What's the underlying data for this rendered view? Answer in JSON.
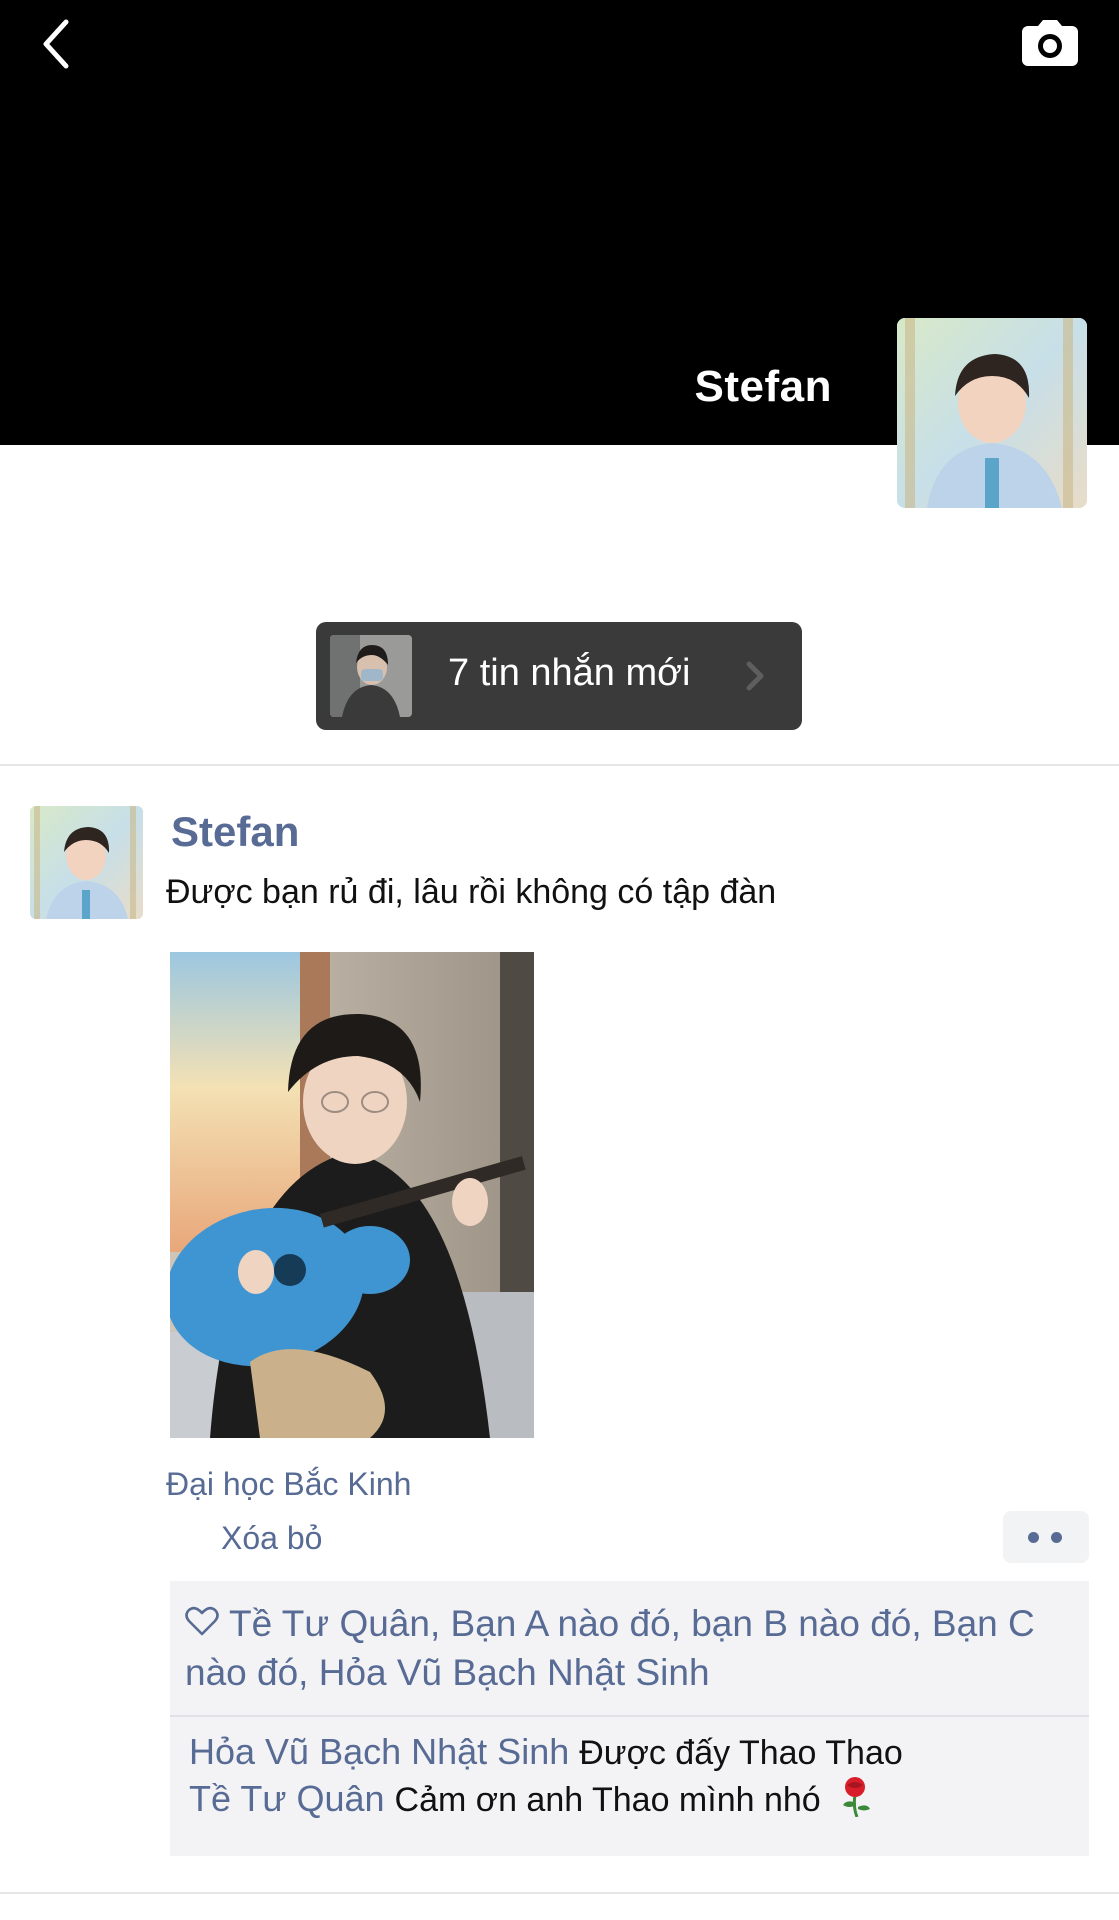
{
  "header": {
    "back_icon": "back-chevron-icon",
    "camera_icon": "camera-icon",
    "profile_name": "Stefan"
  },
  "new_messages": {
    "label": "7 tin nhắn mới",
    "chevron_icon": "chevron-right-icon"
  },
  "post": {
    "author": "Stefan",
    "text": "Được bạn rủ đi, lâu rồi không có tập đàn",
    "location": "Đại học Bắc Kinh",
    "delete_label": "Xóa bỏ",
    "more_icon": "more-dots-icon",
    "likes_icon": "heart-outline-icon",
    "likes": "Tề Tư Quân, Bạn A nào đó, bạn B nào đó, Bạn C nào đó, Hỏa Vũ Bạch Nhật Sinh",
    "comments": [
      {
        "name": "Hỏa Vũ Bạch Nhật Sinh",
        "text": "Được đấy Thao Thao"
      },
      {
        "name": "Tề Tư Quân",
        "text": "Cảm ơn anh Thao mình nhó"
      }
    ],
    "rose_icon": "rose-emoji-icon"
  },
  "colors": {
    "link": "#576b95",
    "cover_bg": "#000000",
    "banner_bg": "#3a3a3a",
    "interaction_bg": "#f3f3f5"
  }
}
